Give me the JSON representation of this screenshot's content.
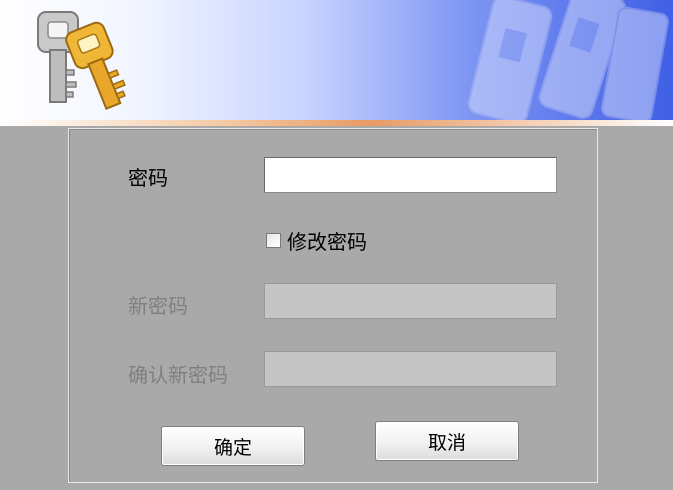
{
  "banner": {
    "icon": "keys-icon",
    "background_icon": "keys-watermark-icon"
  },
  "form": {
    "password_label": "密码",
    "password_value": "",
    "change_password_checkbox_label": "修改密码",
    "change_password_checked": false,
    "new_password_label": "新密码",
    "new_password_value": "",
    "confirm_password_label": "确认新密码",
    "confirm_password_value": ""
  },
  "buttons": {
    "ok_label": "确定",
    "cancel_label": "取消"
  }
}
